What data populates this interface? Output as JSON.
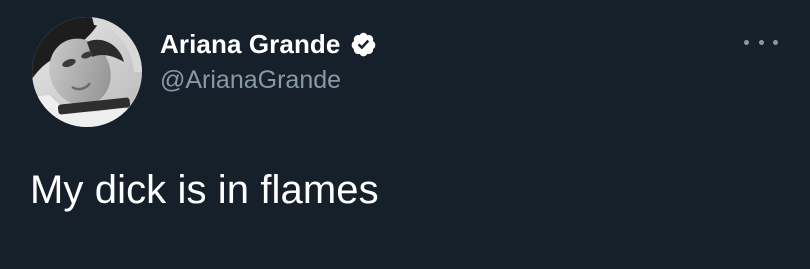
{
  "tweet": {
    "author": {
      "display_name": "Ariana Grande",
      "handle": "@ArianaGrande",
      "verified": true,
      "avatar_icon": "profile-photo"
    },
    "text": "My dick is in flames",
    "more_icon": "more-horizontal-icon"
  },
  "colors": {
    "background": "#15202b",
    "primary_text": "#ffffff",
    "secondary_text": "#8899a6",
    "verified_badge": "#ffffff"
  }
}
